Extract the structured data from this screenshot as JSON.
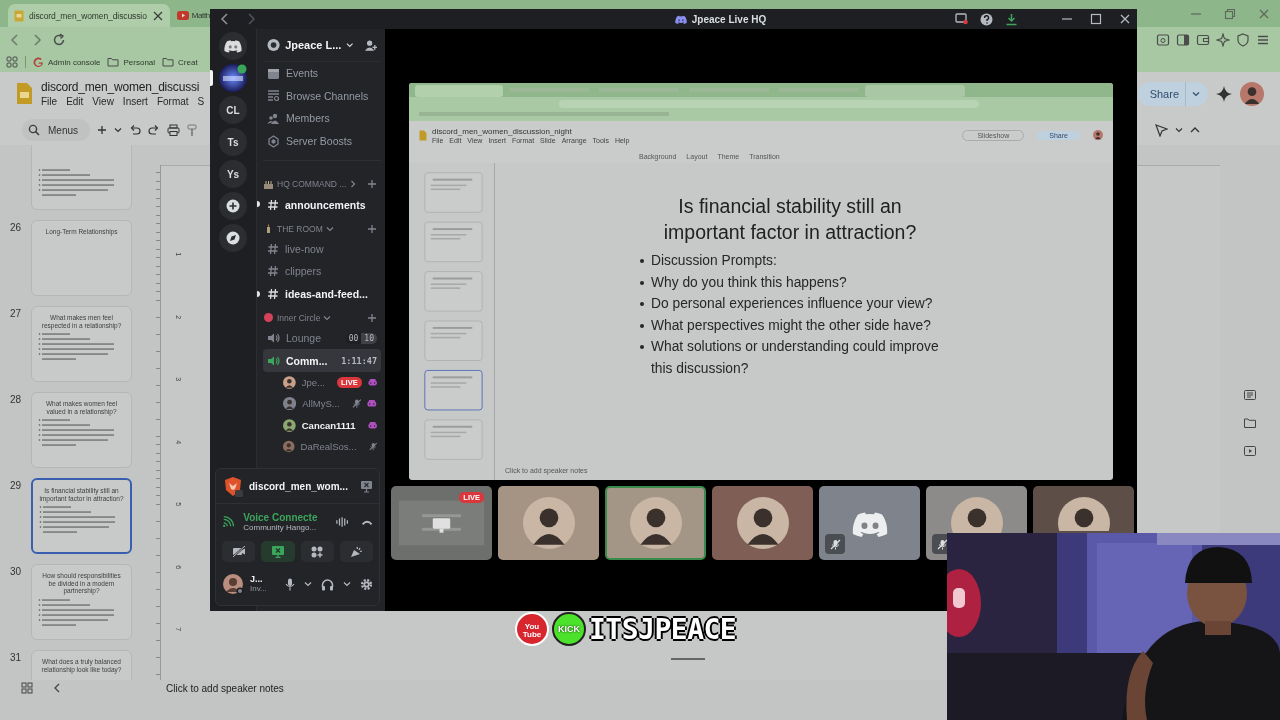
{
  "browser": {
    "tabs": [
      {
        "label": "discord_men_women_discussio",
        "selected": true,
        "kind": "slides"
      },
      {
        "label": "Matth",
        "selected": false,
        "kind": "youtube"
      }
    ],
    "bookmarks": [
      {
        "kind": "google",
        "label": "Admin console"
      },
      {
        "kind": "folder",
        "label": "Personal"
      },
      {
        "kind": "folder",
        "label": "Creat"
      }
    ]
  },
  "slides": {
    "title": "discord_men_women_discussi",
    "menu": [
      "File",
      "Edit",
      "View",
      "Insert",
      "Format",
      "S"
    ],
    "search": "Menus",
    "share": "Share",
    "ruler": [
      "1",
      "2",
      "3",
      "4",
      "5",
      "6",
      "7"
    ],
    "filmstrip": [
      {
        "kind": "prompts",
        "selected": false
      },
      {
        "number": "26",
        "kind": "title",
        "title": "Long-Term Relationships",
        "selected": false
      },
      {
        "number": "27",
        "kind": "prompts",
        "title": "What makes men feel respected in a relationship?",
        "selected": false
      },
      {
        "number": "28",
        "kind": "prompts",
        "title": "What makes women feel valued in a relationship?",
        "selected": false
      },
      {
        "number": "29",
        "kind": "prompts",
        "title": "Is financial stability still an important factor in attraction?",
        "selected": true
      },
      {
        "number": "30",
        "kind": "prompts",
        "title": "How should responsibilities be divided in a modern partnership?",
        "selected": false
      },
      {
        "number": "31",
        "kind": "title",
        "title": "What does a truly balanced relationship look like today?",
        "selected": false
      }
    ],
    "speaker_notes": "Click to add speaker notes"
  },
  "discord": {
    "title": "Jpeace Live HQ",
    "servers": [
      {
        "kind": "home",
        "selected": false
      },
      {
        "kind": "server",
        "selected": true
      },
      {
        "kind": "initials",
        "label": "CL",
        "selected": false
      },
      {
        "kind": "initials",
        "label": "Ts",
        "selected": false
      },
      {
        "kind": "initials",
        "label": "Ys",
        "selected": false
      },
      {
        "kind": "add",
        "selected": false
      },
      {
        "kind": "discover",
        "selected": false
      }
    ],
    "server_name": "Jpeace L...",
    "nav": [
      {
        "kind": "calendar",
        "label": "Events"
      },
      {
        "kind": "browse",
        "label": "Browse Channels"
      },
      {
        "kind": "members",
        "label": "Members"
      },
      {
        "kind": "boost",
        "label": "Server Boosts"
      }
    ],
    "sections": [
      {
        "kind": "cake",
        "name": "HQ COMMAND ...",
        "expanded": false,
        "channels": [
          {
            "kind": "text",
            "name": "announcements",
            "unread": true
          }
        ]
      },
      {
        "kind": "candle",
        "name": "THE ROOM",
        "expanded": true,
        "channels": [
          {
            "kind": "text",
            "name": "live-now",
            "unread": false
          },
          {
            "kind": "text",
            "name": "clippers",
            "unread": false
          },
          {
            "kind": "text",
            "name": "ideas-and-feed...",
            "unread": true
          }
        ]
      },
      {
        "kind": "dot",
        "name": "Inner Circle",
        "expanded": true,
        "channels": [
          {
            "kind": "voice",
            "name": "Lounge",
            "selected": false,
            "counts": [
              "00",
              "10"
            ]
          },
          {
            "kind": "voice",
            "name": "Comm...",
            "selected": true,
            "timer": "1:11:47",
            "members": [
              {
                "name": "Jpe...",
                "live": "LIVE",
                "muted": false,
                "speaking": false,
                "activity": true,
                "color": "#c9a08a"
              },
              {
                "name": "AllMyS...",
                "muted": true,
                "speaking": false,
                "activity": true,
                "color": "#7d828c"
              },
              {
                "name": "Cancan1111",
                "muted": false,
                "speaking": true,
                "activity": true,
                "color": "#8aa870"
              },
              {
                "name": "DaRealSos...",
                "muted": true,
                "speaking": false,
                "activity": false,
                "color": "#8a6d60"
              }
            ]
          }
        ]
      }
    ],
    "stream_panel": {
      "title": "discord_men_wom..."
    },
    "voice": {
      "status": "Voice Connecte",
      "channel": "Community Hango..."
    },
    "actions": [
      {
        "kind": "camera",
        "active": false
      },
      {
        "kind": "screen",
        "active": true
      },
      {
        "kind": "activities",
        "active": false
      },
      {
        "kind": "soundboard",
        "active": false
      }
    ],
    "user": {
      "name": "J...",
      "status": "Inv..."
    },
    "stream": {
      "doc_title": "discord_men_women_discussion_night",
      "menu": [
        "File",
        "Edit",
        "View",
        "Insert",
        "Format",
        "Slide",
        "Arrange",
        "Tools",
        "Help"
      ],
      "toolbar": [
        "Background",
        "Layout",
        "Theme",
        "Transition"
      ],
      "slideshow": "Slideshow",
      "share": "Share",
      "slide_title": "Is financial stability still an important factor in attraction?",
      "bullets": [
        "Discussion Prompts:",
        "Why do you think this happens?",
        "Do personal experiences influence your view?",
        "What perspectives might the other side have?",
        "What solutions or understanding could improve this discussion?"
      ],
      "speaker_notes": "Click to add speaker notes"
    },
    "tiles": [
      {
        "kind": "stream",
        "live": "LIVE",
        "selected": false,
        "muted": false,
        "color": "#6d6f6d"
      },
      {
        "kind": "avatar",
        "selected": false,
        "muted": false,
        "color": "#a59484"
      },
      {
        "kind": "avatar",
        "selected": true,
        "muted": false,
        "color": "#a39686"
      },
      {
        "kind": "avatar",
        "selected": false,
        "muted": false,
        "color": "#7f5e55"
      },
      {
        "kind": "logo",
        "selected": false,
        "muted": true,
        "color": "#7e838c"
      },
      {
        "kind": "avatar",
        "selected": false,
        "muted": true,
        "color": "#8c8b8a"
      },
      {
        "kind": "avatar",
        "selected": false,
        "muted": false,
        "color": "#5e4e48"
      }
    ]
  },
  "overlay": {
    "youtube": "You Tube",
    "kick": "KICK",
    "handle": "ITSJPEACE"
  }
}
